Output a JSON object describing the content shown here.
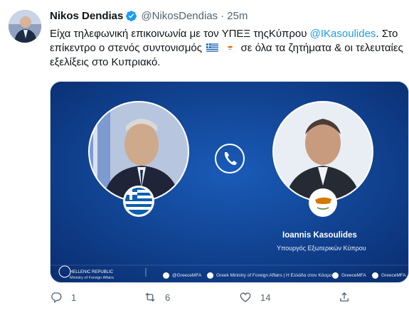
{
  "tweet": {
    "author_name": "Nikos Dendias",
    "author_handle": "@NikosDendias",
    "separator": "·",
    "time": "25m",
    "text_part1": "Είχα τηλεφωνική επικοινωνία με τον ΥΠΕΞ τηςΚύπρου",
    "mention": "@IKasoulides",
    "text_part2": ". Στο επίκεντρο ο στενός συντονισμός",
    "text_part3": "σε όλα τα ζητήματα & οι τελευταίες εξελίξεις στο Κυπριακό.",
    "flags": [
      "greece-flag",
      "cyprus-flag"
    ]
  },
  "media": {
    "person_name": "Ioannis Kasoulides",
    "person_title": "Υπουργός Εξωτερικών Κύπρου",
    "org_name": "HELLENIC REPUBLIC",
    "org_sub": "Ministry of Foreign Affairs",
    "footer_items": [
      {
        "icon": "twitter-icon",
        "text": "@GreeceMFA"
      },
      {
        "icon": "facebook-icon",
        "text": "Greek Ministry of Foreign Affairs | Η Ελλάδα στον Κόσμο"
      },
      {
        "icon": "instagram-icon",
        "text": "GreeceMFA"
      },
      {
        "icon": "linkedin-icon",
        "text": "GreeceMFA"
      }
    ],
    "colors": {
      "background": "#0c3c8a",
      "accent": "#1d9bf0"
    }
  },
  "actions": {
    "reply_count": "1",
    "retweet_count": "6",
    "like_count": "14",
    "share_count": ""
  }
}
